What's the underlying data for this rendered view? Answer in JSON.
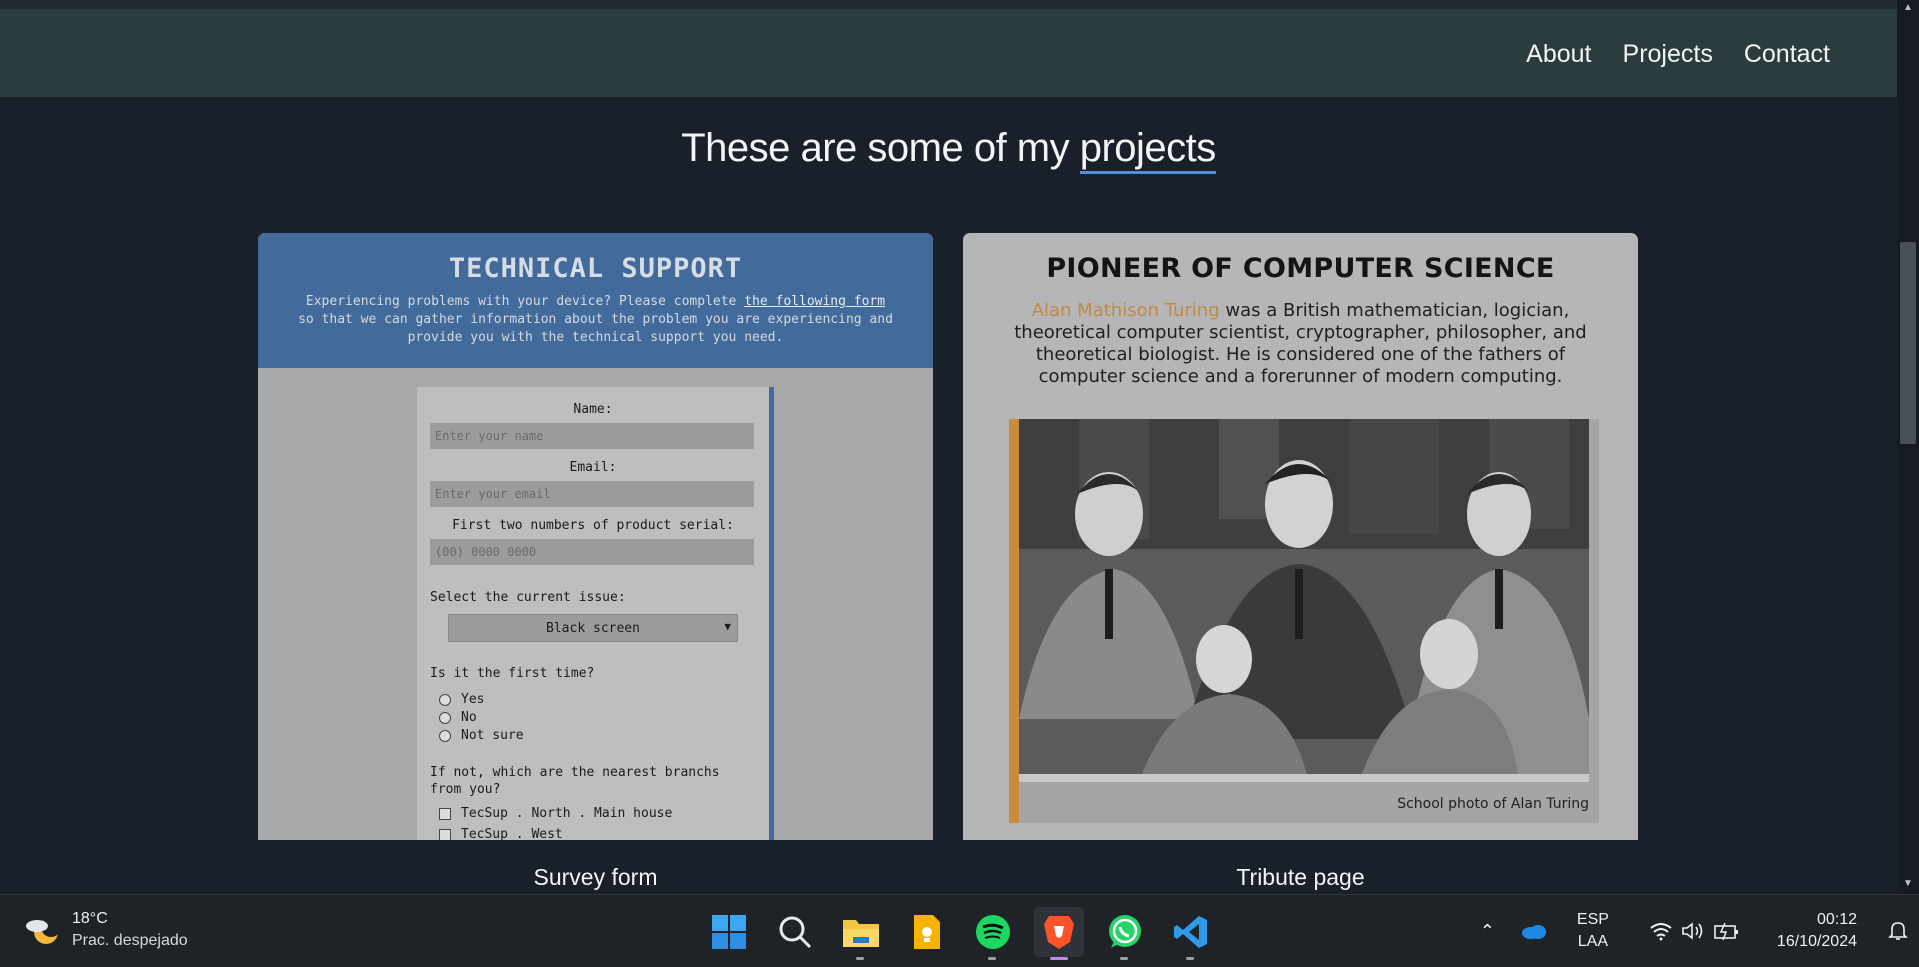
{
  "nav": {
    "links": [
      "About",
      "Projects",
      "Contact"
    ]
  },
  "headline": {
    "prefix": "These are some of my ",
    "highlight": "projects"
  },
  "survey": {
    "title": "TECHNICAL SUPPORT",
    "intro_before": "Experiencing problems with your device? Please complete ",
    "intro_link": "the following form",
    "intro_after": " so that we can gather information about the problem you are experiencing and provide you with the technical support you need.",
    "name_label": "Name:",
    "name_placeholder": "Enter your name",
    "email_label": "Email:",
    "email_placeholder": "Enter your email",
    "serial_label": "First two numbers of product serial:",
    "serial_placeholder": "(00) 0000 0000",
    "issue_label": "Select the current issue:",
    "issue_value": "Black screen",
    "first_time_label": "Is it the first time?",
    "first_time_options": [
      "Yes",
      "No",
      "Not sure"
    ],
    "branches_label": "If not, which are the nearest branchs from you?",
    "branches": [
      "TecSup . North . Main house",
      "TecSup . West"
    ],
    "caption": "Survey form"
  },
  "tribute": {
    "title": "PIONEER OF COMPUTER SCIENCE",
    "name": "Alan Mathison Turing",
    "text": " was a British mathematician, logician, theoretical computer scientist, cryptographer, philosopher, and theoretical biologist. He is considered one of the fathers of computer science and a forerunner of modern computing.",
    "photo_caption": "School photo of Alan Turing",
    "caption": "Tribute page"
  },
  "taskbar": {
    "temperature": "18°C",
    "condition": "Prac. despejado",
    "apps": [
      "windows-start-icon",
      "search-icon",
      "file-explorer-icon",
      "keep-notes-icon",
      "spotify-icon",
      "brave-browser-icon",
      "whatsapp-icon",
      "vscode-icon"
    ],
    "language": "ESP",
    "layout": "LAA",
    "time": "00:12",
    "date": "16/10/2024"
  },
  "colors": {
    "accent": "#4e8fd6",
    "survey_header": "#426a9a",
    "tribute_accent": "#c98b3d",
    "background": "#1a2029",
    "navbar": "#2b3c3f"
  }
}
